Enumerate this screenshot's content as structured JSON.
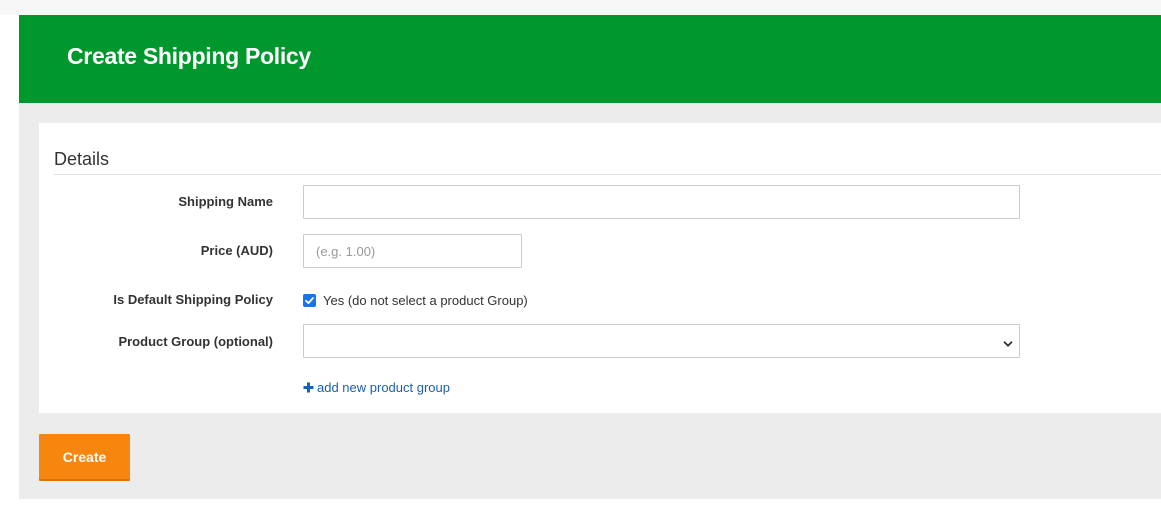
{
  "header": {
    "title": "Create Shipping Policy",
    "color": "#00982d"
  },
  "details": {
    "section_title": "Details",
    "fields": {
      "shipping_name": {
        "label": "Shipping Name",
        "value": "",
        "placeholder": ""
      },
      "price": {
        "label": "Price (AUD)",
        "value": "",
        "placeholder": "(e.g. 1.00)"
      },
      "is_default": {
        "label": "Is Default Shipping Policy",
        "checked": true,
        "option_label": "Yes (do not select a product Group)"
      },
      "product_group": {
        "label": "Product Group (optional)",
        "selected": ""
      }
    },
    "add_group_link": "add new product group"
  },
  "actions": {
    "create_label": "Create",
    "create_color": "#f7860f"
  }
}
